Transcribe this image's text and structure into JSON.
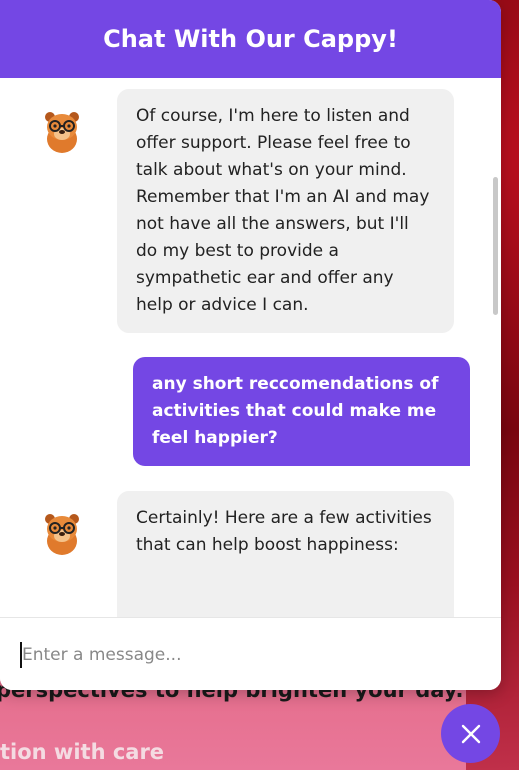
{
  "chat": {
    "title": "Chat With Our Cappy!",
    "input_placeholder": "Enter a message...",
    "messages": [
      {
        "role": "bot",
        "text": "Of course, I'm here to listen and offer support. Please feel free to talk about what's on your mind. Remember that I'm an AI and may not have all the answers, but I'll do my best to provide a sympathetic ear and offer any help or advice I can."
      },
      {
        "role": "user",
        "text": "any short reccomendations of activities that could make me feel happier?"
      },
      {
        "role": "bot",
        "text": "Certainly! Here are a few activities that can help boost happiness:"
      }
    ]
  },
  "background": {
    "line1": "perspectives to help brighten your day.",
    "line2": "tion with care"
  },
  "icons": {
    "avatar": "capybara-avatar-icon",
    "close": "close-icon"
  },
  "colors": {
    "accent": "#7447e4",
    "bot_bubble": "#f0f0f0"
  }
}
